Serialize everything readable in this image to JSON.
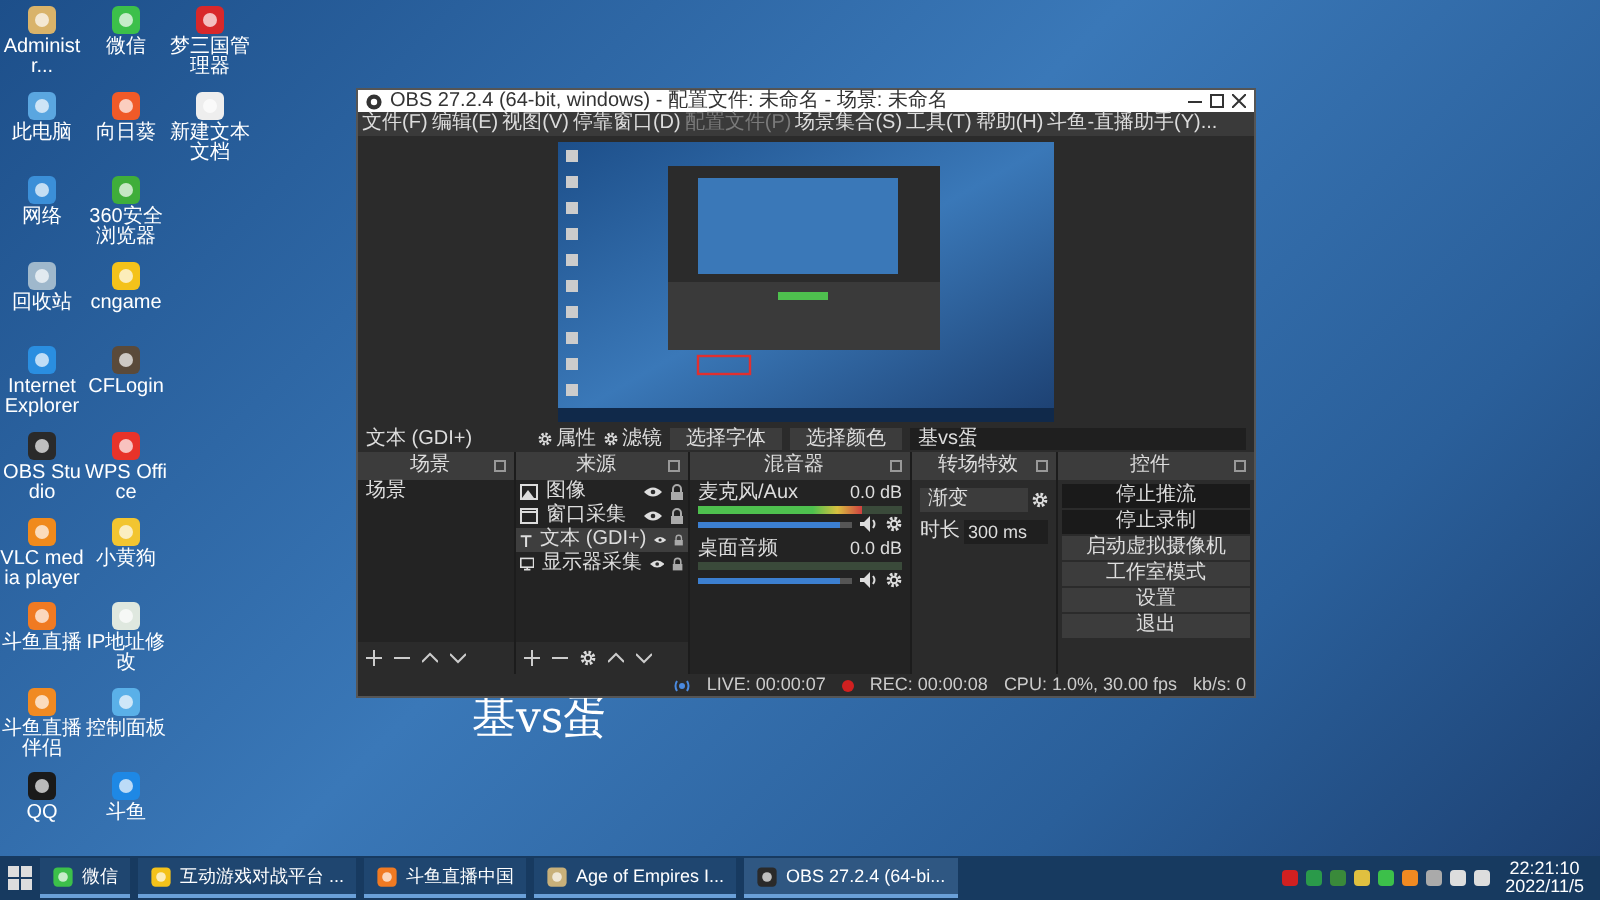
{
  "desktop": {
    "icons": [
      {
        "label": "Administr...",
        "color": "#d9b36a"
      },
      {
        "label": "此电脑",
        "color": "#5aa6e0"
      },
      {
        "label": "网络",
        "color": "#3b8fd8"
      },
      {
        "label": "回收站",
        "color": "#9fb8cc"
      },
      {
        "label": "Internet Explorer",
        "color": "#2a8ee0"
      },
      {
        "label": "OBS Studio",
        "color": "#2a2a2a"
      },
      {
        "label": "VLC media player",
        "color": "#f08a1c"
      },
      {
        "label": "斗鱼直播",
        "color": "#f07a22"
      },
      {
        "label": "斗鱼直播伴侣",
        "color": "#f08a22"
      },
      {
        "label": "QQ",
        "color": "#1a1a1a"
      },
      {
        "label": "微信",
        "color": "#3cc04a"
      },
      {
        "label": "向日葵",
        "color": "#f05a28"
      },
      {
        "label": "360安全浏览器",
        "color": "#3fae3a"
      },
      {
        "label": "cngame",
        "color": "#f4c21a"
      },
      {
        "label": "CFLogin",
        "color": "#5a4a3a"
      },
      {
        "label": "WPS Office",
        "color": "#e8332a"
      },
      {
        "label": "小黄狗",
        "color": "#f2c530"
      },
      {
        "label": "IP地址修改",
        "color": "#dfe8df"
      },
      {
        "label": "控制面板",
        "color": "#5ab0e8"
      },
      {
        "label": "斗鱼",
        "color": "#1e88e5"
      },
      {
        "label": "梦三国管理器",
        "color": "#d8282a"
      },
      {
        "label": "新建文本文档",
        "color": "#eeeeee"
      }
    ]
  },
  "stream_overlay_text": "基vs蛋",
  "obs_window": {
    "title": "OBS 27.2.4 (64-bit, windows) - 配置文件: 未命名 - 场景: 未命名",
    "menu": [
      {
        "label": "文件(F)",
        "disabled": false
      },
      {
        "label": "编辑(E)",
        "disabled": false
      },
      {
        "label": "视图(V)",
        "disabled": false
      },
      {
        "label": "停靠窗口(D)",
        "disabled": false
      },
      {
        "label": "配置文件(P)",
        "disabled": true
      },
      {
        "label": "场景集合(S)",
        "disabled": false
      },
      {
        "label": "工具(T)",
        "disabled": false
      },
      {
        "label": "帮助(H)",
        "disabled": false
      },
      {
        "label": "斗鱼-直播助手(Y)...",
        "disabled": false
      }
    ],
    "source_toolbar": {
      "source": "文本 (GDI+)",
      "buttons": [
        "属性",
        "滤镜"
      ],
      "font_button": "选择字体",
      "color_button": "选择颜色",
      "text_value": "基vs蛋"
    },
    "scenes": {
      "title": "场景",
      "items": [
        {
          "label": "场景",
          "selected": false
        }
      ]
    },
    "sources": {
      "title": "来源",
      "items": [
        {
          "label": "图像",
          "kind": "image",
          "selected": false
        },
        {
          "label": "窗口采集",
          "kind": "window",
          "selected": false
        },
        {
          "label": "文本 (GDI+)",
          "kind": "text",
          "selected": true
        },
        {
          "label": "显示器采集",
          "kind": "monitor",
          "selected": false
        }
      ]
    },
    "mixer": {
      "title": "混音器",
      "channels": [
        {
          "name": "麦克风/Aux",
          "reading": "0.0 dB",
          "meter": {
            "level": 0.8
          },
          "volume": {
            "level": 0.92
          }
        },
        {
          "name": "桌面音频",
          "reading": "0.0 dB",
          "meter": {
            "level": 0.0
          },
          "volume": {
            "level": 0.92
          }
        }
      ]
    },
    "transitions": {
      "title": "转场特效",
      "transition": "渐变",
      "duration_label": "时长",
      "duration": "300 ms"
    },
    "controls": {
      "title": "控件",
      "buttons": [
        {
          "label": "停止推流",
          "active": true
        },
        {
          "label": "停止录制",
          "active": true
        },
        {
          "label": "启动虚拟摄像机",
          "active": false
        },
        {
          "label": "工作室模式",
          "active": false
        },
        {
          "label": "设置",
          "active": false
        },
        {
          "label": "退出",
          "active": false
        }
      ]
    },
    "status_bar": {
      "live": "LIVE: 00:00:07",
      "rec": "REC: 00:00:08",
      "cpu": "CPU: 1.0%, 30.00 fps",
      "kbps": "kb/s: 0"
    }
  },
  "taskbar": {
    "items": [
      {
        "label": "微信",
        "color": "#3cc04a",
        "selected": false
      },
      {
        "label": "互动游戏对战平台 ...",
        "color": "#f4c21a",
        "selected": false
      },
      {
        "label": "斗鱼直播中国",
        "color": "#f07a22",
        "selected": false
      },
      {
        "label": "Age of Empires I...",
        "color": "#c8b07a",
        "selected": false
      },
      {
        "label": "OBS 27.2.4 (64-bi...",
        "color": "#2a2a2a",
        "selected": true
      }
    ],
    "time": "22:21:10",
    "date": "2022/11/5"
  }
}
